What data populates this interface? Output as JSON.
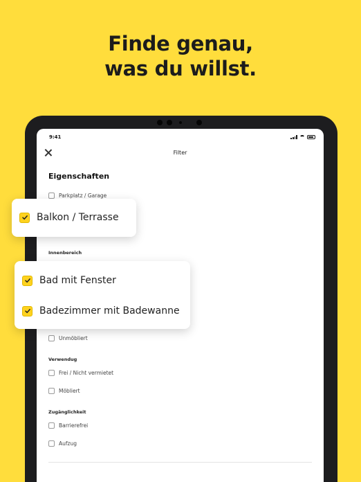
{
  "headline": {
    "line1": "Finde genau,",
    "line2": "was du willst."
  },
  "status": {
    "time": "9:41"
  },
  "header": {
    "title": "Filter"
  },
  "section": {
    "title": "Eigenschaften"
  },
  "options": {
    "parking": "Parkplatz / Garage",
    "unfurnished": "Unmöbliert",
    "free": "Frei / Nicht vermietet",
    "furnished": "Möbliert",
    "barrierfree": "Barrierefrei",
    "elevator": "Aufzug"
  },
  "groups": {
    "interior": "Innenbereich",
    "usage": "Verwendug",
    "access": "Zugänglichkeit"
  },
  "cards": {
    "balcony": "Balkon / Terrasse",
    "bath_window": "Bad mit Fenster",
    "bathtub": "Badezimmer mit Badewanne"
  },
  "colors": {
    "background": "#FFDD3C",
    "accent": "#FFD21F"
  }
}
